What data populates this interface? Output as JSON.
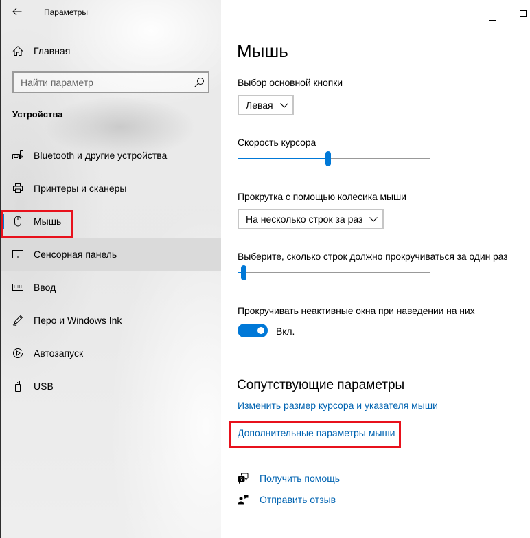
{
  "window": {
    "title": "Параметры",
    "back_icon": "back-arrow-icon",
    "minimize_icon": "minimize-icon",
    "maximize_icon": "maximize-icon"
  },
  "colors": {
    "accent": "#0078d7",
    "link": "#0063b1",
    "highlight": "#e8111c",
    "nav_hover": "#dadada"
  },
  "sidebar": {
    "home": {
      "label": "Главная",
      "icon": "home-icon"
    },
    "search": {
      "placeholder": "Найти параметр",
      "value": "",
      "icon": "search-icon"
    },
    "section_title": "Устройства",
    "items": [
      {
        "label": "Bluetooth и другие устройства",
        "icon": "bluetooth-devices-icon",
        "selected": false,
        "hovered": false,
        "highlighted": false
      },
      {
        "label": "Принтеры и сканеры",
        "icon": "printer-icon",
        "selected": false,
        "hovered": false,
        "highlighted": false
      },
      {
        "label": "Мышь",
        "icon": "mouse-icon",
        "selected": true,
        "hovered": false,
        "highlighted": true
      },
      {
        "label": "Сенсорная панель",
        "icon": "touchpad-icon",
        "selected": false,
        "hovered": true,
        "highlighted": false
      },
      {
        "label": "Ввод",
        "icon": "keyboard-icon",
        "selected": false,
        "hovered": false,
        "highlighted": false
      },
      {
        "label": "Перо и Windows Ink",
        "icon": "pen-icon",
        "selected": false,
        "hovered": false,
        "highlighted": false
      },
      {
        "label": "Автозапуск",
        "icon": "autoplay-icon",
        "selected": false,
        "hovered": false,
        "highlighted": false
      },
      {
        "label": "USB",
        "icon": "usb-icon",
        "selected": false,
        "hovered": false,
        "highlighted": false
      }
    ]
  },
  "main": {
    "title": "Мышь",
    "primary_button": {
      "label": "Выбор основной кнопки",
      "selected": "Левая",
      "icon": "chevron-down-icon"
    },
    "cursor_speed": {
      "label": "Скорость курсора",
      "level": 0.47
    },
    "wheel_scroll": {
      "label": "Прокрутка с помощью колесика мыши",
      "selected": "На несколько строк за раз",
      "icon": "chevron-down-icon"
    },
    "scroll_lines": {
      "label": "Выберите, сколько строк должно прокручиваться за один раз",
      "level": 0.02
    },
    "inactive_scroll": {
      "label": "Прокручивать неактивные окна при наведении на них",
      "on": true,
      "state_label": "Вкл."
    },
    "related": {
      "title": "Сопутствующие параметры",
      "links": [
        {
          "label": "Изменить размер курсора и указателя мыши",
          "highlighted": false
        },
        {
          "label": "Дополнительные параметры мыши",
          "highlighted": true
        }
      ]
    },
    "support": [
      {
        "label": "Получить помощь",
        "icon": "help-icon"
      },
      {
        "label": "Отправить отзыв",
        "icon": "feedback-icon"
      }
    ]
  }
}
